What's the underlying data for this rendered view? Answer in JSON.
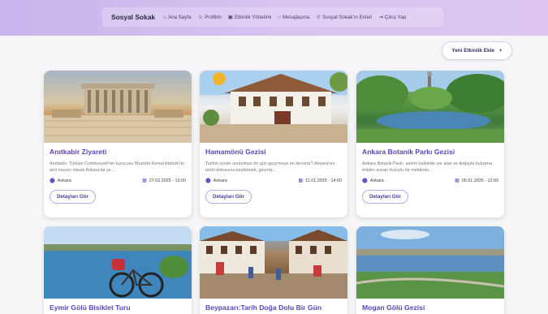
{
  "nav": {
    "brand": "Sosyal Sokak",
    "items": [
      {
        "label": "Ana Sayfa",
        "icon": "home-icon"
      },
      {
        "label": "Profilim",
        "icon": "user-icon"
      },
      {
        "label": "Etkinlik Yönetimi",
        "icon": "calendar-icon"
      },
      {
        "label": "Mesajlaşma",
        "icon": "chat-icon"
      },
      {
        "label": "Sosyal Sokak'ın Enleri",
        "icon": "trophy-icon"
      },
      {
        "label": "Çıkış Yap",
        "icon": "logout-icon"
      }
    ]
  },
  "actions": {
    "add_event": "Yeni Etkinlik Ekle",
    "add_symbol": "+"
  },
  "events": [
    {
      "title": "Anıtkabir Ziyareti",
      "desc": "Anıtkabir, Türkiye Cumhuriyeti'nin kurucusu Mustafa Kemal Atatürk'ün anıt mezarı olarak Ankara'da ye...",
      "city": "Ankara",
      "date": "27.02.2025 - 13:00",
      "button": "Detayları Gör"
    },
    {
      "title": "Hamamönü Gezisi",
      "desc": "Tarihin içinde unutulmaz bir gün geçirmeye ne dersiniz? Ankara'nın tarihi dokusunu keşfetmek, geçmiş...",
      "city": "Ankara",
      "date": "11.01.2025 - 14:00",
      "button": "Detayları Gör"
    },
    {
      "title": "Ankara Botanik Parkı Gezisi",
      "desc": "Ankara Botanik Parkı, şehrin kalbinde yer alan ve doğayla buluşma imkânı sunan huzurlu bir mekândır...",
      "city": "Ankara",
      "date": "06.01.2025 - 12:00",
      "button": "Detayları Gör"
    },
    {
      "title": "Eymir Gölü Bisiklet Turu"
    },
    {
      "title": "Beypazarı:Tarih Doğa Dolu Bir Gün"
    },
    {
      "title": "Mogan Gölü Gezisi"
    }
  ],
  "colors": {
    "accent": "#5b45b8",
    "header_start": "#c7b6ec",
    "header_end": "#dcc6ef"
  }
}
